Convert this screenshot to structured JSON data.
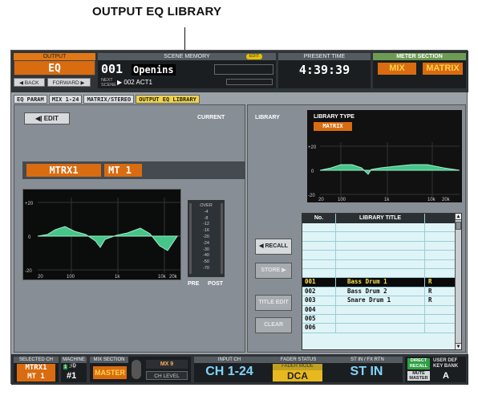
{
  "callout": "OUTPUT EQ LIBRARY",
  "top": {
    "output_label": "OUTPUT",
    "output_value": "EQ",
    "back": "◀ BACK",
    "forward": "FORWARD ▶",
    "scene_header": "SCENE MEMORY",
    "edit_badge": "EDIT",
    "scene_number": "001",
    "scene_name": "Openins",
    "next_label": "NEXT SCENE",
    "next_value": "▶ 002 ACT1",
    "present_time_header": "PRESENT TIME",
    "time": "4:39:39",
    "meter_header": "METER SECTION",
    "meter_mix": "MIX",
    "meter_matrix": "MATRIX"
  },
  "tabs": [
    "EQ PARAM",
    "MIX 1-24",
    "MATRIX/STEREO",
    "OUTPUT EQ LIBRARY"
  ],
  "left": {
    "edit": "◀| EDIT",
    "current": "CURRENT",
    "channel": "MTRX1",
    "channel_short": "MT 1",
    "meter_scale": [
      "OVER",
      "-4",
      "-8",
      "-12",
      "-16",
      "-20",
      "-24",
      "-30",
      "-40",
      "-50",
      "-70"
    ],
    "pre": "PRE",
    "post": "POST",
    "axis": {
      "y_top": "+20",
      "y_mid": "0",
      "y_bot": "-20",
      "x": [
        "20",
        "100",
        "1k",
        "10k",
        "20k"
      ]
    }
  },
  "right": {
    "library": "LIBRARY",
    "library_type_label": "LIBRARY TYPE",
    "library_type_value": "MATRIX",
    "axis": {
      "y_top": "+20",
      "y_mid": "0",
      "y_bot": "-20",
      "x": [
        "20",
        "100",
        "1k",
        "10k",
        "20k"
      ]
    },
    "recall": "◀ RECALL",
    "store": "STORE ▶",
    "title_edit": "TITLE EDIT",
    "clear": "CLEAR",
    "table_headers": [
      "No.",
      "LIBRARY TITLE",
      ""
    ],
    "rows": [
      {
        "no": "",
        "title": "",
        "r": ""
      },
      {
        "no": "",
        "title": "",
        "r": ""
      },
      {
        "no": "",
        "title": "",
        "r": ""
      },
      {
        "no": "",
        "title": "",
        "r": ""
      },
      {
        "no": "",
        "title": "",
        "r": ""
      },
      {
        "no": "",
        "title": "",
        "r": ""
      },
      {
        "no": "001",
        "title": "Bass Drum 1",
        "r": "R"
      },
      {
        "no": "002",
        "title": "Bass Drum 2",
        "r": "R"
      },
      {
        "no": "003",
        "title": "Snare Drum 1",
        "r": "R"
      },
      {
        "no": "004",
        "title": "",
        "r": ""
      },
      {
        "no": "005",
        "title": "",
        "r": ""
      },
      {
        "no": "006",
        "title": "",
        "r": ""
      }
    ]
  },
  "bottom": {
    "selected_ch_label": "SELECTED CH",
    "selected_ch_1": "MTRX1",
    "selected_ch_2": "MT 1",
    "machine_id_label": "MACHINE ID",
    "machine_nums": [
      "1",
      "2",
      "3"
    ],
    "machine_value": "#1",
    "mix_section_label": "MIX SECTION",
    "mix_section_value": "MASTER",
    "mx_value": "MX 9",
    "ch_level": "CH LEVEL",
    "input_ch_label": "INPUT CH",
    "input_ch_value": "CH 1-24",
    "fader_status_label": "FADER STATUS",
    "fader_mode_label": "FADER MODE",
    "fader_mode_value": "DCA",
    "st_in_label": "ST IN / FX RTN",
    "st_in_value": "ST IN",
    "direct_recall": "DIRECT RECALL",
    "mute_master": "MUTE MASTER",
    "user_def_label": "USER DEF KEY BANK",
    "user_def_value": "A"
  }
}
